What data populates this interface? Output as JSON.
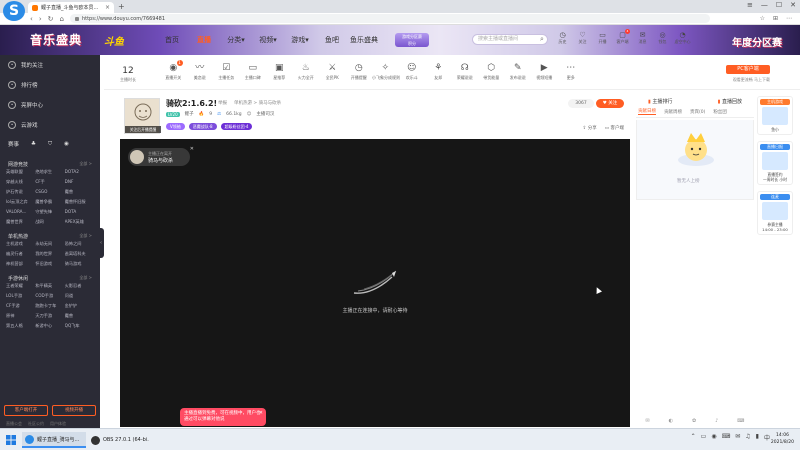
{
  "browser": {
    "tab_title": "鲤子直播_斗鱼与欧本员...",
    "url": "https://www.douyu.com/7669481",
    "win_min": "—",
    "win_max": "☐",
    "win_close": "✕",
    "win_menu": "≡"
  },
  "header": {
    "logo_text": "音乐盛典",
    "logo_sub": "斗鱼",
    "nav": [
      {
        "label": "首页"
      },
      {
        "label": "直播"
      },
      {
        "label": "分类▾"
      },
      {
        "label": "视频▾"
      },
      {
        "label": "游戏▾"
      },
      {
        "label": "鱼吧"
      },
      {
        "label": "鱼乐盛典"
      }
    ],
    "promo_line1": "游戏分区赛",
    "promo_line2": "积分",
    "search_placeholder": "搜索主播或直播间",
    "icons": [
      {
        "label": "历史",
        "glyph": "◷"
      },
      {
        "label": "关注",
        "glyph": "♡"
      },
      {
        "label": "开播",
        "glyph": "▭"
      },
      {
        "label": "客户端",
        "glyph": "▢",
        "badge": "4"
      },
      {
        "label": "消息",
        "glyph": "✉"
      },
      {
        "label": "钱包",
        "glyph": "◎"
      },
      {
        "label": "虚空中心",
        "glyph": "◔"
      }
    ],
    "anniv_text": "年度分区赛"
  },
  "sidebar": {
    "top_items": [
      {
        "label": "我的关注",
        "icon": "heart-icon"
      },
      {
        "label": "排行榜",
        "icon": "rank-icon"
      },
      {
        "label": "亮屏中心",
        "icon": "center-icon"
      },
      {
        "label": "云游戏",
        "icon": "cloud-icon"
      }
    ],
    "games_row": [
      "赛事",
      "♣",
      "⛉",
      "◉"
    ],
    "sections": [
      {
        "title": "网游竞技",
        "more": "全部 >",
        "items": [
          "英雄联盟",
          "绝地求生",
          "DOTA2",
          "穿越火线",
          "CF手",
          "DNF",
          "炉石传说",
          "CSGO",
          "魔兽",
          "lol云顶之弈",
          "魔兽争霸",
          "魔兽怀旧服",
          "VALORA...",
          "守望先锋",
          "DOTA",
          "魔兽世界",
          "战网",
          "APEX英雄"
        ]
      },
      {
        "title": "单机热游",
        "more": "全部 >",
        "items": [
          "主机游戏",
          "永劫无间",
          "恐怖之间",
          "幽灵行者",
          "我的世界",
          "逃离塔科夫",
          "神机营部",
          "怀旧游戏",
          "骑马游戏"
        ]
      },
      {
        "title": "手游休闲",
        "more": "全部 >",
        "items": [
          "王者荣耀",
          "和平精英",
          "火影忍者",
          "LOL手游",
          "COD手游",
          "问道",
          "CF手游",
          "跑跑卡丁车",
          "金铲铲",
          "原神",
          "天刀手游",
          "魔兽",
          "第五人格",
          "新游中心",
          "QQ飞车"
        ]
      }
    ],
    "btn_client": "客户端打开",
    "btn_phone": "视频开播",
    "bottom_links": [
      "直播公会",
      "社区公约",
      "用户体验"
    ],
    "toggle_glyph": "‹"
  },
  "category_bar": {
    "count": "12",
    "count_label": "主播时长",
    "items": [
      {
        "label": "直播开关",
        "glyph": "◉",
        "badge": "1"
      },
      {
        "label": "美恋说",
        "glyph": "〰"
      },
      {
        "label": "主播任务",
        "glyph": "☑"
      },
      {
        "label": "主播口碑",
        "glyph": "▭"
      },
      {
        "label": "星推荐",
        "glyph": "▣"
      },
      {
        "label": "火力全开",
        "glyph": "♨"
      },
      {
        "label": "全民PK",
        "glyph": "⚔"
      },
      {
        "label": "开播提醒",
        "glyph": "◷"
      },
      {
        "label": "小飞象分成规则",
        "glyph": "✧"
      },
      {
        "label": "欢乐斗",
        "glyph": "☺"
      },
      {
        "label": "友邦",
        "glyph": "⚘"
      },
      {
        "label": "荣耀说说",
        "glyph": "☊"
      },
      {
        "label": "带货能量",
        "glyph": "⬡"
      },
      {
        "label": "发布说说",
        "glyph": "✎"
      },
      {
        "label": "视频短播",
        "glyph": "▶"
      },
      {
        "label": "更多",
        "glyph": "⋯"
      }
    ],
    "pc_client": "PC客户端",
    "pc_sub": "观看更流畅 马上下载"
  },
  "room": {
    "avatar_label": "关注后开播提醒",
    "title": "骑砍2:1.6.2!",
    "meta": [
      "举报",
      "单机热游 > 骑马与砍杀"
    ],
    "level": "LV20",
    "anchor_name": "鲤子",
    "hot_count": "9",
    "weight": "66.1kg",
    "fans_label": "主播司汉",
    "tags": [
      "V领袖",
      "恶魔战队·8",
      "超级粉丝团·4"
    ],
    "follow_count": "3067",
    "follow_label": "♥ 关注",
    "actions": [
      "分享",
      "客户端"
    ]
  },
  "player": {
    "anchor_status": "主播正在离开",
    "anchor_name": "骑马与砍杀",
    "message": "主播正在连接中，请耐心等待",
    "close_glyph": "✕"
  },
  "toast": {
    "text": "主播直播到免费，可在视频中，用户也通过可以弹幕对他说",
    "close_glyph": "✕"
  },
  "right_panel": {
    "head_left": "主播排行",
    "head_right": "直播回放",
    "tabs": [
      "贡献日榜",
      "贡献周榜",
      "贵宾(0)",
      "粉丝团"
    ],
    "empty_caption": "暂无人上榜",
    "bottom_icons": [
      "✉",
      "◐",
      "✿",
      "♪",
      "⌨"
    ]
  },
  "far_right": [
    {
      "head": "主机游戏",
      "orange": true,
      "text": "鱼小",
      "sub": ""
    },
    {
      "head": "直播日报",
      "orange": false,
      "text": "直播签约",
      "sub": "一周时长 小时"
    },
    {
      "head": "连麦",
      "orange": false,
      "text": "参赛主播",
      "sub": "14:00 - 23:00"
    }
  ],
  "taskbar": {
    "app1": "鲤子直播_骑马与...",
    "app2": "OBS 27.0.1 (64-bi...",
    "tray": [
      "⌃",
      "▭",
      "◉",
      "⌨",
      "✉",
      "♫",
      "▮",
      "中"
    ],
    "time": "14:06",
    "date": "2021/8/20"
  },
  "colors": {
    "accent": "#ff5d23",
    "sidebar_bg": "#2b2b36",
    "player_bg": "#161616",
    "toast_bg": "#ff4b63",
    "tag_purple": "#9c6bff"
  }
}
